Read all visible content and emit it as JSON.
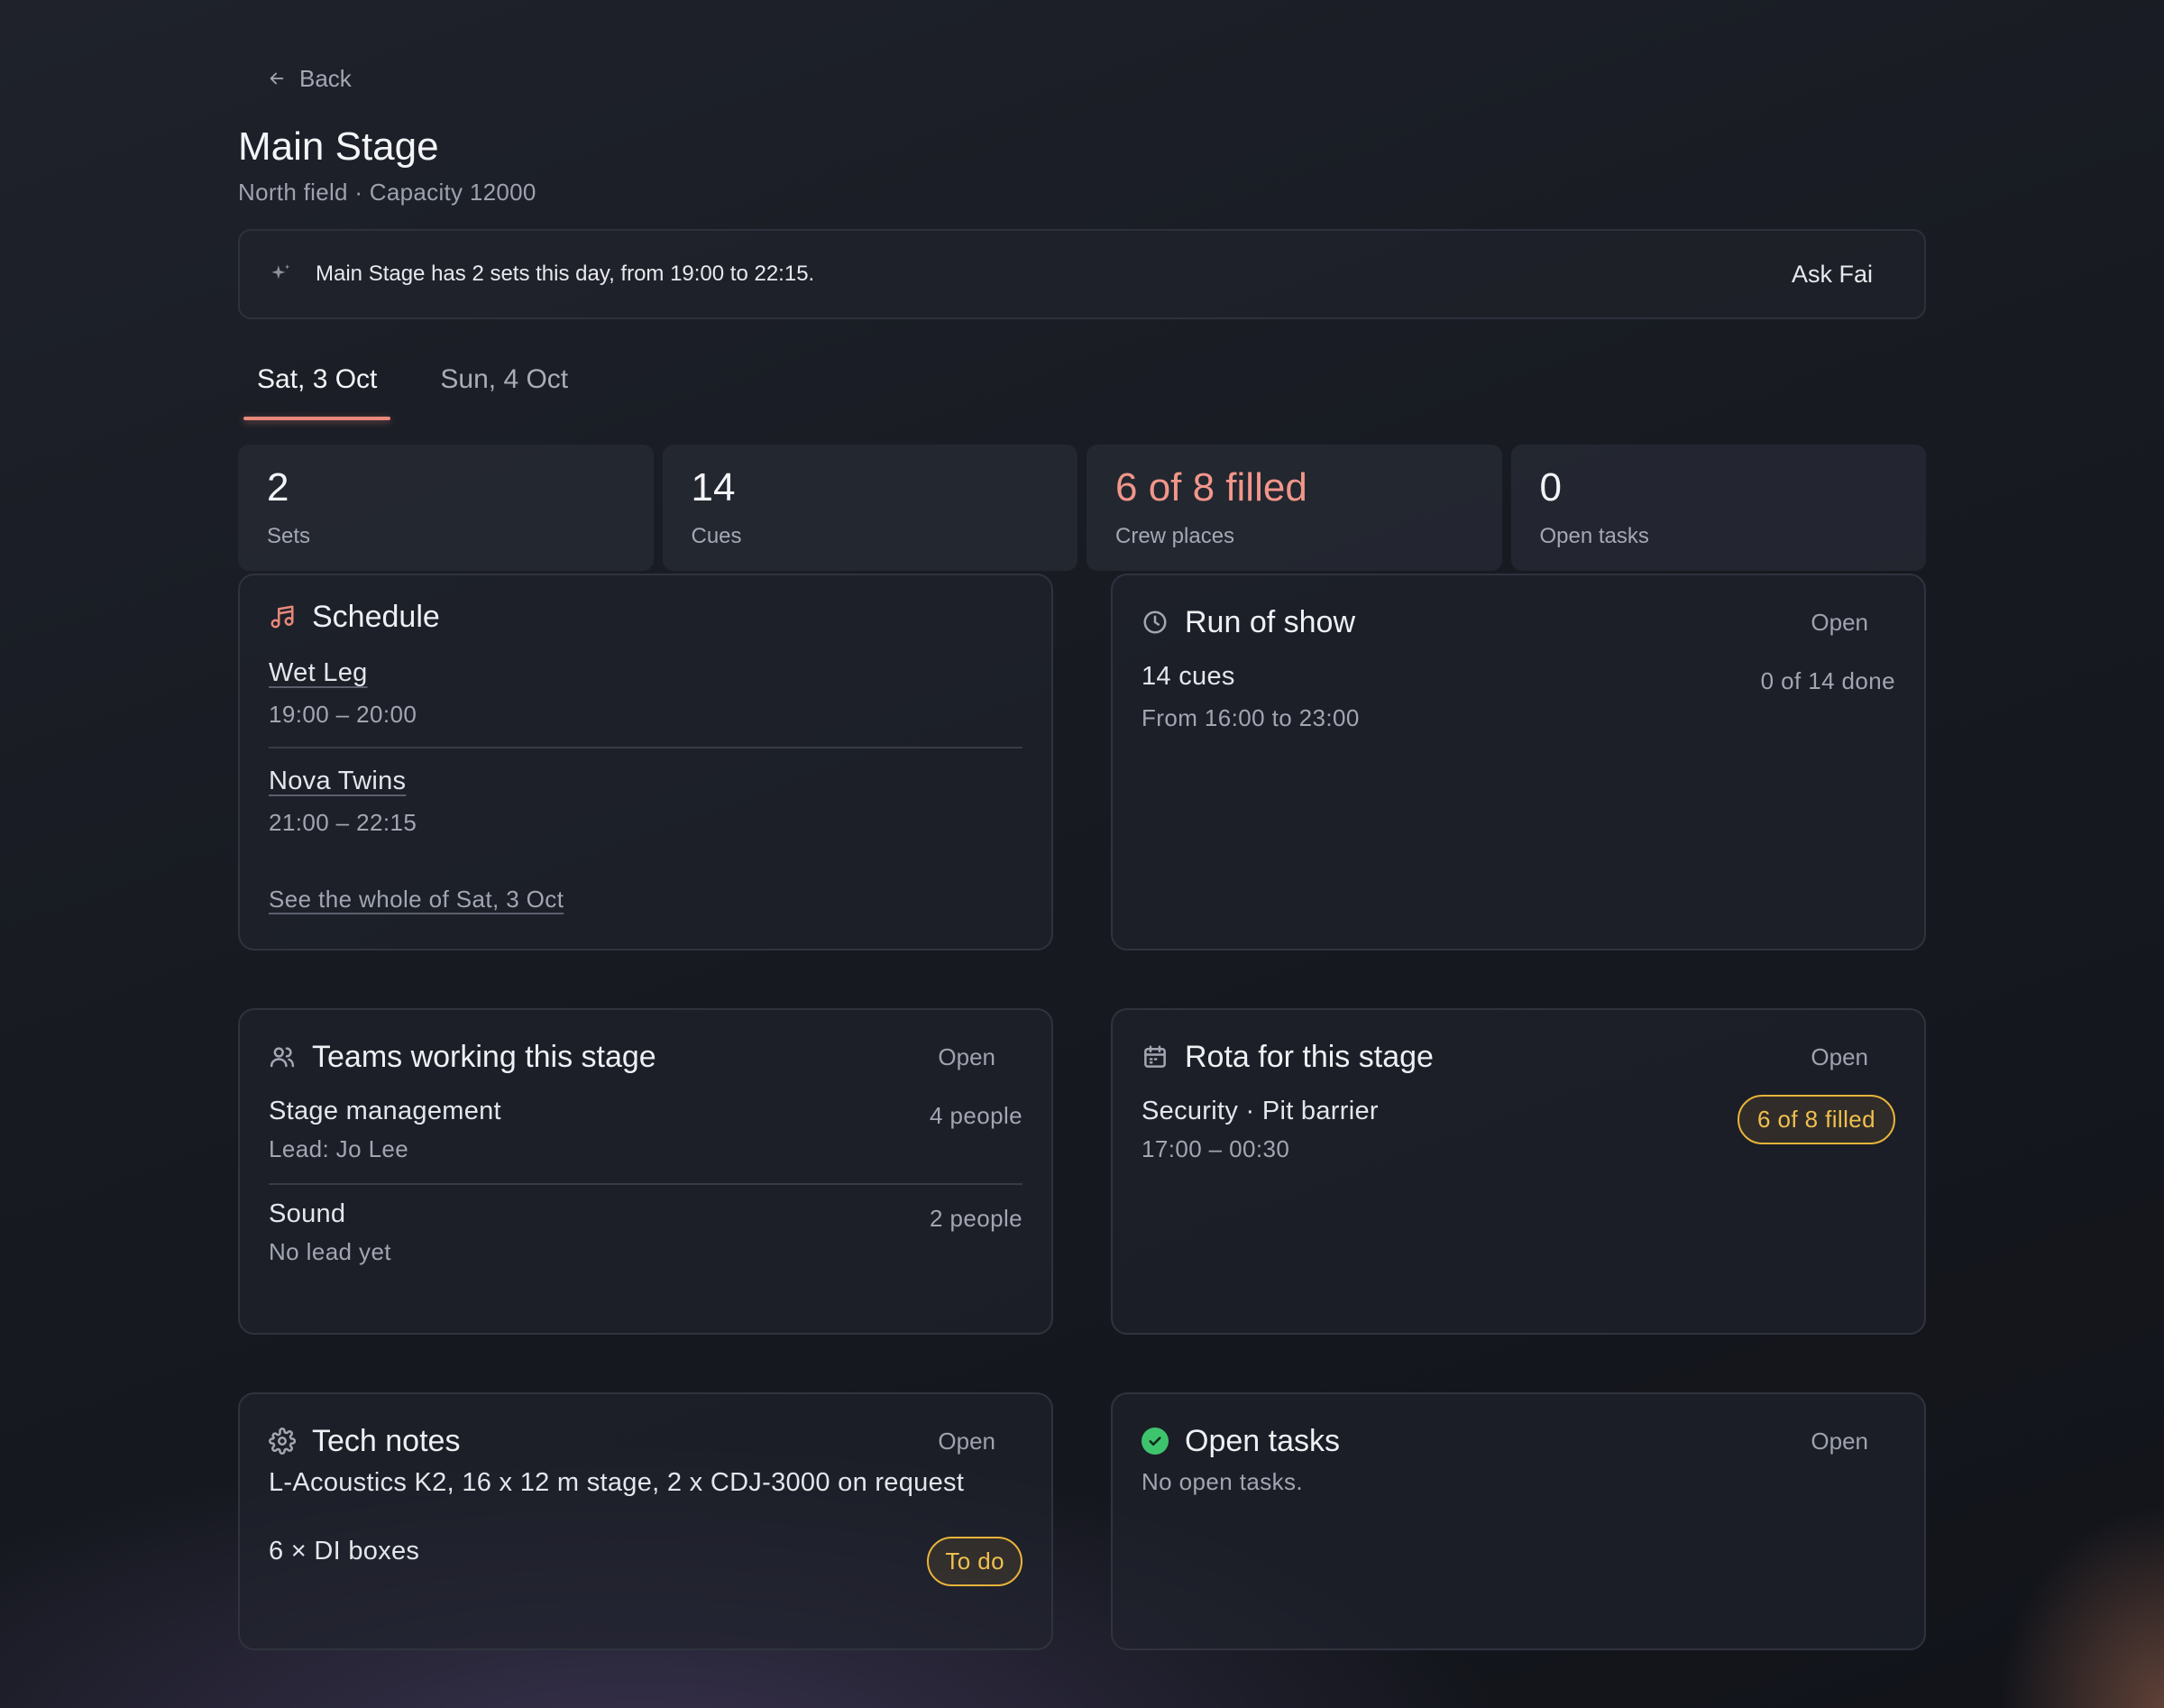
{
  "nav": {
    "back_label": "Back"
  },
  "header": {
    "title": "Main Stage",
    "subtitle": "North field · Capacity 12000"
  },
  "assistant": {
    "message": "Main Stage has 2 sets this day, from 19:00 to 22:15.",
    "ask_label": "Ask Fai"
  },
  "tabs": [
    {
      "label": "Sat, 3 Oct",
      "active": true
    },
    {
      "label": "Sun, 4 Oct",
      "active": false
    }
  ],
  "stats": [
    {
      "value": "2",
      "label": "Sets"
    },
    {
      "value": "14",
      "label": "Cues"
    },
    {
      "value": "6 of 8 filled",
      "label": "Crew places",
      "accent": "#f2968a"
    },
    {
      "value": "0",
      "label": "Open tasks"
    }
  ],
  "schedule": {
    "title": "Schedule",
    "sets": [
      {
        "artist": "Wet Leg",
        "time": "19:00 – 20:00"
      },
      {
        "artist": "Nova Twins",
        "time": "21:00 – 22:15"
      }
    ],
    "see_all": "See the whole of Sat, 3 Oct"
  },
  "run_of_show": {
    "title": "Run of show",
    "open_label": "Open",
    "cues": "14 cues",
    "range": "From 16:00 to 23:00",
    "progress": "0 of 14 done"
  },
  "teams": {
    "title": "Teams working this stage",
    "open_label": "Open",
    "items": [
      {
        "name": "Stage management",
        "lead": "Lead: Jo Lee",
        "count": "4 people"
      },
      {
        "name": "Sound",
        "lead": "No lead yet",
        "count": "2 people"
      }
    ]
  },
  "rota": {
    "title": "Rota for this stage",
    "open_label": "Open",
    "role": "Security · Pit barrier",
    "time": "17:00 – 00:30",
    "badge": "6 of 8 filled",
    "badge_color": "#e9b43a"
  },
  "tech_notes": {
    "title": "Tech notes",
    "open_label": "Open",
    "specs": "L-Acoustics K2, 16 x 12 m stage, 2 x CDJ-3000 on request",
    "item": "6 × DI boxes",
    "item_status": "To do"
  },
  "open_tasks": {
    "title": "Open tasks",
    "open_label": "Open",
    "empty": "No open tasks.",
    "icon_color": "#3ec46d"
  },
  "icons": [
    "arrow-left-icon",
    "sparkle-icon",
    "music-icon",
    "clock-icon",
    "users-icon",
    "calendar-icon",
    "gear-icon",
    "check-circle-icon"
  ]
}
